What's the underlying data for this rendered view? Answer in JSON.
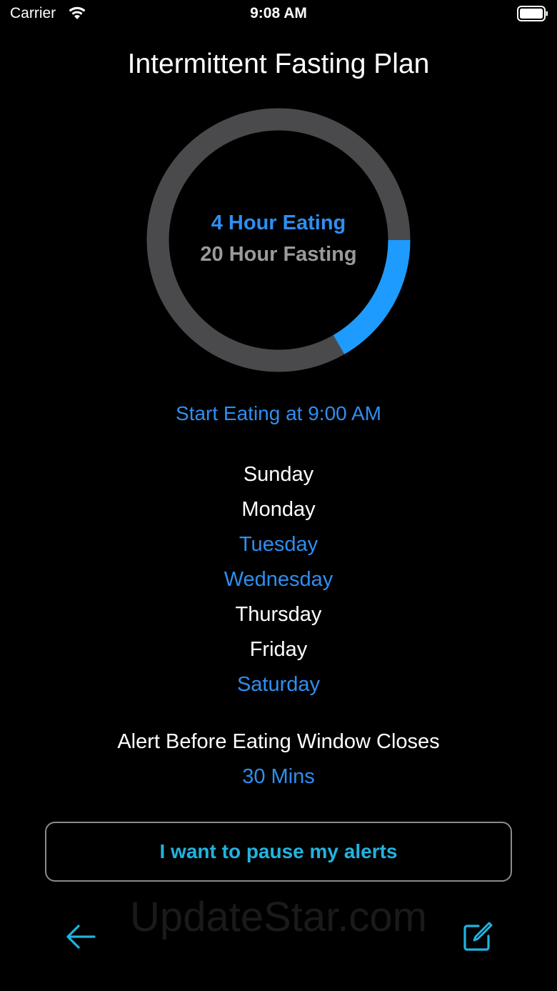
{
  "status_bar": {
    "carrier": "Carrier",
    "time": "9:08 AM",
    "wifi_icon": "wifi-icon",
    "battery_icon": "battery-icon"
  },
  "title": "Intermittent Fasting Plan",
  "ring": {
    "eating_label": "4 Hour Eating",
    "fasting_label": "20 Hour Fasting",
    "eating_hours": 4,
    "fasting_hours": 20,
    "eating_color": "#1e9bff",
    "fasting_color": "#4a4a4c"
  },
  "start_eating": "Start Eating at 9:00 AM",
  "days": [
    {
      "label": "Sunday",
      "selected": false
    },
    {
      "label": "Monday",
      "selected": false
    },
    {
      "label": "Tuesday",
      "selected": true
    },
    {
      "label": "Wednesday",
      "selected": true
    },
    {
      "label": "Thursday",
      "selected": false
    },
    {
      "label": "Friday",
      "selected": false
    },
    {
      "label": "Saturday",
      "selected": true
    }
  ],
  "alert": {
    "label": "Alert Before Eating Window Closes",
    "value": "30 Mins"
  },
  "pause_button": "I want to pause my alerts",
  "watermark": "UpdateStar.com",
  "toolbar": {
    "back_icon": "arrow-left-icon",
    "edit_icon": "edit-icon"
  },
  "colors": {
    "accent": "#2f8ef0",
    "button_text": "#22b3e0",
    "muted": "#9a9a9a"
  }
}
